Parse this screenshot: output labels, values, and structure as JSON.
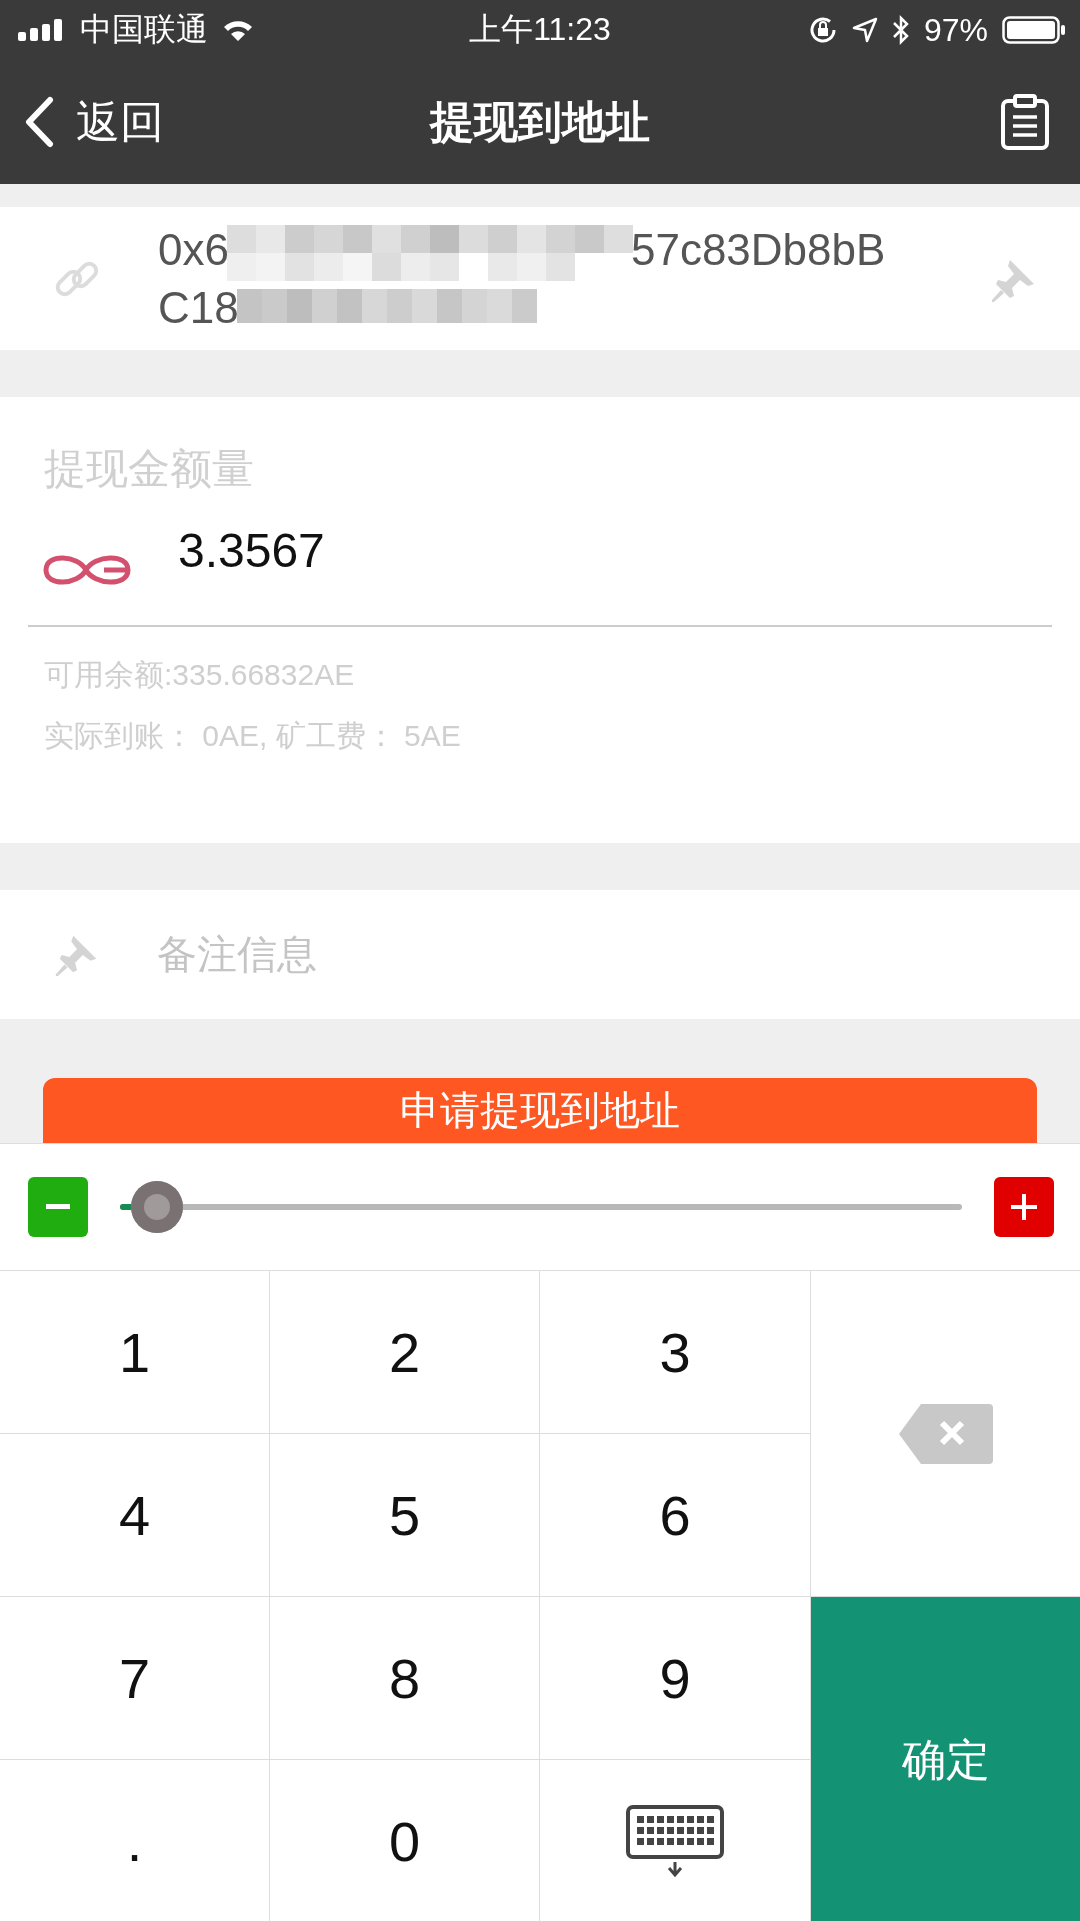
{
  "status_bar": {
    "carrier": "中国联通",
    "time": "上午11:23",
    "battery": "97%"
  },
  "nav": {
    "back": "返回",
    "title": "提现到地址"
  },
  "address": {
    "start": "0x6",
    "middle_end": "57c83Db8bB",
    "line2": "C18"
  },
  "amount": {
    "label": "提现金额量",
    "value": "3.3567",
    "balance": "可用余额:335.66832AE",
    "fee": "实际到账： 0AE, 矿工费： 5AE"
  },
  "memo": {
    "placeholder": "备注信息"
  },
  "submit": "申请提现到地址",
  "slider": {
    "level": 0.02
  },
  "keys": [
    {
      "kind": "digit",
      "label": "1"
    },
    {
      "kind": "digit",
      "label": "2"
    },
    {
      "kind": "digit",
      "label": "3"
    },
    {
      "kind": "backspace"
    },
    {
      "kind": "digit",
      "label": "4"
    },
    {
      "kind": "digit",
      "label": "5"
    },
    {
      "kind": "digit",
      "label": "6"
    },
    {
      "kind": "digit",
      "label": "7"
    },
    {
      "kind": "digit",
      "label": "8"
    },
    {
      "kind": "digit",
      "label": "9"
    },
    {
      "kind": "confirm",
      "label": "确定"
    },
    {
      "kind": "digit",
      "label": "."
    },
    {
      "kind": "digit",
      "label": "0"
    },
    {
      "kind": "hide"
    }
  ]
}
